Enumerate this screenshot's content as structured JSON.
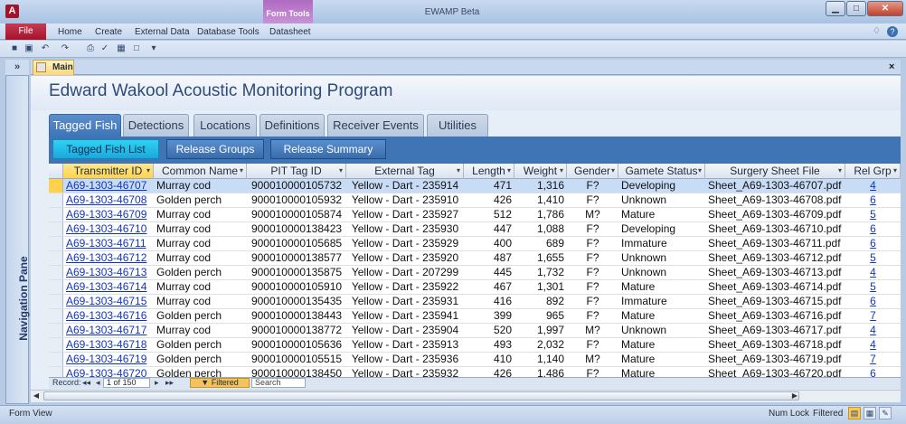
{
  "window": {
    "title": "EWAMP Beta",
    "context_group": "Form Tools",
    "controls": {
      "minimize": "▁",
      "maximize": "□",
      "close": "✕"
    }
  },
  "app_icon_letter": "A",
  "ribbon": {
    "file": "File",
    "tabs": [
      "Home",
      "Create",
      "External Data",
      "Database Tools",
      "Datasheet"
    ],
    "help": "?"
  },
  "qat": {
    "icons": [
      "save-icon",
      "save-as-icon",
      "undo-icon",
      "redo-icon",
      "print-preview-icon",
      "spelling-icon",
      "excel-icon",
      "new-icon",
      "customize-icon"
    ]
  },
  "nav_pane": {
    "label": "Navigation Pane",
    "toggle": "»"
  },
  "document_tab": {
    "label": "Main",
    "close": "×"
  },
  "app_title": "Edward Wakool Acoustic Monitoring Program",
  "main_tabs": [
    "Tagged Fish",
    "Detections",
    "Locations",
    "Definitions",
    "Receiver Events",
    "Utilities"
  ],
  "sub_buttons": [
    "Tagged Fish List",
    "Release Groups",
    "Release Summary"
  ],
  "table": {
    "columns": [
      "Transmitter ID",
      "Common Name",
      "PIT Tag ID",
      "External Tag",
      "Length",
      "Weight",
      "Gender",
      "Gamete Status",
      "Surgery Sheet File",
      "Rel Grp"
    ],
    "rows": [
      [
        "A69-1303-46707",
        "Murray cod",
        "900010000105732",
        "Yellow - Dart - 235914",
        "471",
        "1,316",
        "F?",
        "Developing",
        "Sheet_A69-1303-46707.pdf",
        "4"
      ],
      [
        "A69-1303-46708",
        "Golden perch",
        "900010000105932",
        "Yellow - Dart - 235910",
        "426",
        "1,410",
        "F?",
        "Unknown",
        "Sheet_A69-1303-46708.pdf",
        "6"
      ],
      [
        "A69-1303-46709",
        "Murray cod",
        "900010000105874",
        "Yellow - Dart - 235927",
        "512",
        "1,786",
        "M?",
        "Mature",
        "Sheet_A69-1303-46709.pdf",
        "5"
      ],
      [
        "A69-1303-46710",
        "Murray cod",
        "900010000138423",
        "Yellow - Dart - 235930",
        "447",
        "1,088",
        "F?",
        "Developing",
        "Sheet_A69-1303-46710.pdf",
        "6"
      ],
      [
        "A69-1303-46711",
        "Murray cod",
        "900010000105685",
        "Yellow - Dart - 235929",
        "400",
        "689",
        "F?",
        "Immature",
        "Sheet_A69-1303-46711.pdf",
        "6"
      ],
      [
        "A69-1303-46712",
        "Murray cod",
        "900010000138577",
        "Yellow - Dart - 235920",
        "487",
        "1,655",
        "F?",
        "Unknown",
        "Sheet_A69-1303-46712.pdf",
        "5"
      ],
      [
        "A69-1303-46713",
        "Golden perch",
        "900010000135875",
        "Yellow - Dart - 207299",
        "445",
        "1,732",
        "F?",
        "Unknown",
        "Sheet_A69-1303-46713.pdf",
        "4"
      ],
      [
        "A69-1303-46714",
        "Murray cod",
        "900010000105910",
        "Yellow - Dart - 235922",
        "467",
        "1,301",
        "F?",
        "Mature",
        "Sheet_A69-1303-46714.pdf",
        "5"
      ],
      [
        "A69-1303-46715",
        "Murray cod",
        "900010000135435",
        "Yellow - Dart - 235931",
        "416",
        "892",
        "F?",
        "Immature",
        "Sheet_A69-1303-46715.pdf",
        "6"
      ],
      [
        "A69-1303-46716",
        "Golden perch",
        "900010000138443",
        "Yellow - Dart - 235941",
        "399",
        "965",
        "F?",
        "Mature",
        "Sheet_A69-1303-46716.pdf",
        "7"
      ],
      [
        "A69-1303-46717",
        "Murray cod",
        "900010000138772",
        "Yellow - Dart - 235904",
        "520",
        "1,997",
        "M?",
        "Unknown",
        "Sheet_A69-1303-46717.pdf",
        "4"
      ],
      [
        "A69-1303-46718",
        "Golden perch",
        "900010000105636",
        "Yellow - Dart - 235913",
        "493",
        "2,032",
        "F?",
        "Mature",
        "Sheet_A69-1303-46718.pdf",
        "4"
      ],
      [
        "A69-1303-46719",
        "Golden perch",
        "900010000105515",
        "Yellow - Dart - 235936",
        "410",
        "1,140",
        "M?",
        "Mature",
        "Sheet_A69-1303-46719.pdf",
        "7"
      ],
      [
        "A69-1303-46720",
        "Golden perch",
        "900010000138450",
        "Yellow - Dart - 235932",
        "426",
        "1,486",
        "F?",
        "Mature",
        "Sheet_A69-1303-46720.pdf",
        "6"
      ]
    ]
  },
  "record_nav": {
    "label": "Record:",
    "first": "◂◂",
    "prev": "◂",
    "position": "1 of 150",
    "next": "▸",
    "last": "▸▸",
    "filtered": "Filtered",
    "search": "Search"
  },
  "status_bar": {
    "left": "Form View",
    "num_lock": "Num Lock",
    "filtered": "Filtered"
  },
  "colors": {
    "accent": "#3f74b5",
    "selected_tab": "#1ba8dd",
    "file_tab": "#a3132a",
    "context_tab": "#b06ac2"
  }
}
